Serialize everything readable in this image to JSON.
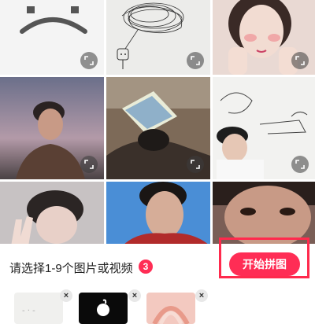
{
  "colors": {
    "accent": "#ff2d55",
    "highlight_frame": "#ff2a4d"
  },
  "grid": {
    "items": [
      {
        "name": "sad-face-drawing",
        "icon": "expand-icon"
      },
      {
        "name": "scribble-balloon-sketch",
        "icon": "expand-icon"
      },
      {
        "name": "girl-hands-on-face-photo",
        "icon": "expand-icon"
      },
      {
        "name": "man-sunset-photo",
        "icon": "expand-icon"
      },
      {
        "name": "man-book-on-face-photo",
        "icon": "expand-icon"
      },
      {
        "name": "sketch-line-art-photo",
        "icon": "expand-icon"
      },
      {
        "name": "peace-sign-photo"
      },
      {
        "name": "man-blue-sky-photo"
      },
      {
        "name": "closeup-eyes-photo"
      }
    ]
  },
  "footer": {
    "prompt": "请选择1-9个图片或视频",
    "selected_count": "3",
    "start_button": "开始拼图",
    "remove_label": "×"
  }
}
